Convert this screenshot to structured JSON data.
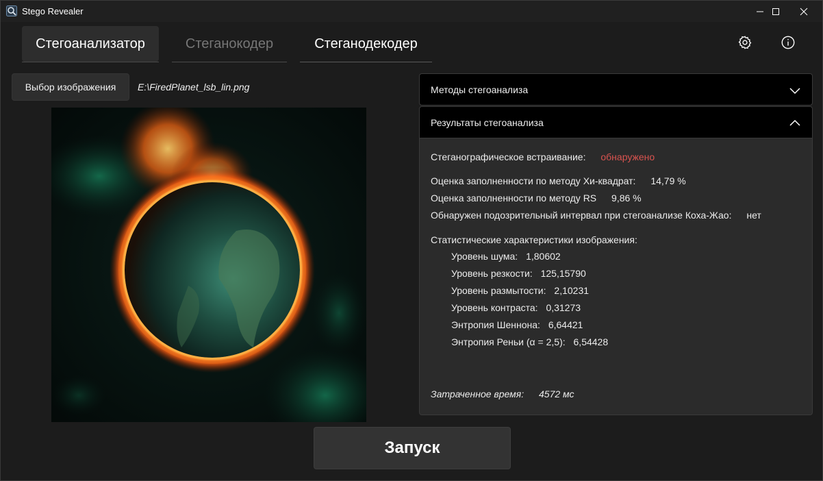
{
  "window": {
    "title": "Stego Revealer",
    "icon": "app-magnifier-icon"
  },
  "titlebar_controls": [
    "minimize-icon",
    "maximize-icon",
    "close-icon"
  ],
  "tabs": [
    {
      "label": "Стегоанализатор",
      "state": "active"
    },
    {
      "label": "Стеганокодер",
      "state": "disabled"
    },
    {
      "label": "Стеганодекодер",
      "state": "normal"
    }
  ],
  "toolbar_icons": [
    "gear-icon",
    "info-icon"
  ],
  "left_panel": {
    "choose_button": "Выбор изображения",
    "file_path": "E:\\FiredPlanet_lsb_lin.png"
  },
  "accordion": {
    "methods_header": "Методы стегоанализа",
    "methods_expanded": false,
    "results_header": "Результаты стегоанализа",
    "results_expanded": true
  },
  "results": {
    "embedding_label": "Стеганографическое встраивание:",
    "embedding_value": "обнаружено",
    "chi_label": "Оценка заполненности по методу Хи-квадрат:",
    "chi_value": "14,79 %",
    "rs_label": "Оценка заполненности по методу RS",
    "rs_value": "9,86 %",
    "koch_label": "Обнаружен подозрительный интервал при стегоанализе Коха-Жао:",
    "koch_value": "нет",
    "stats_header": "Статистические характеристики изображения:",
    "noise_label": "Уровень шума:",
    "noise_value": "1,80602",
    "sharpness_label": "Уровень резкости:",
    "sharpness_value": "125,15790",
    "blur_label": "Уровень размытости:",
    "blur_value": "2,10231",
    "contrast_label": "Уровень контраста:",
    "contrast_value": "0,31273",
    "shannon_label": "Энтропия Шеннона:",
    "shannon_value": "6,64421",
    "renyi_label": "Энтропия Реньи (α = 2,5):",
    "renyi_value": "6,54428",
    "time_label": "Затраченное время:",
    "time_value": "4572 мс"
  },
  "run_button": "Запуск",
  "colors": {
    "background": "#1c1c1c",
    "panel": "#2b2b2b",
    "header": "#000000",
    "detected": "#d9534f",
    "disabled_tab": "#767676"
  }
}
